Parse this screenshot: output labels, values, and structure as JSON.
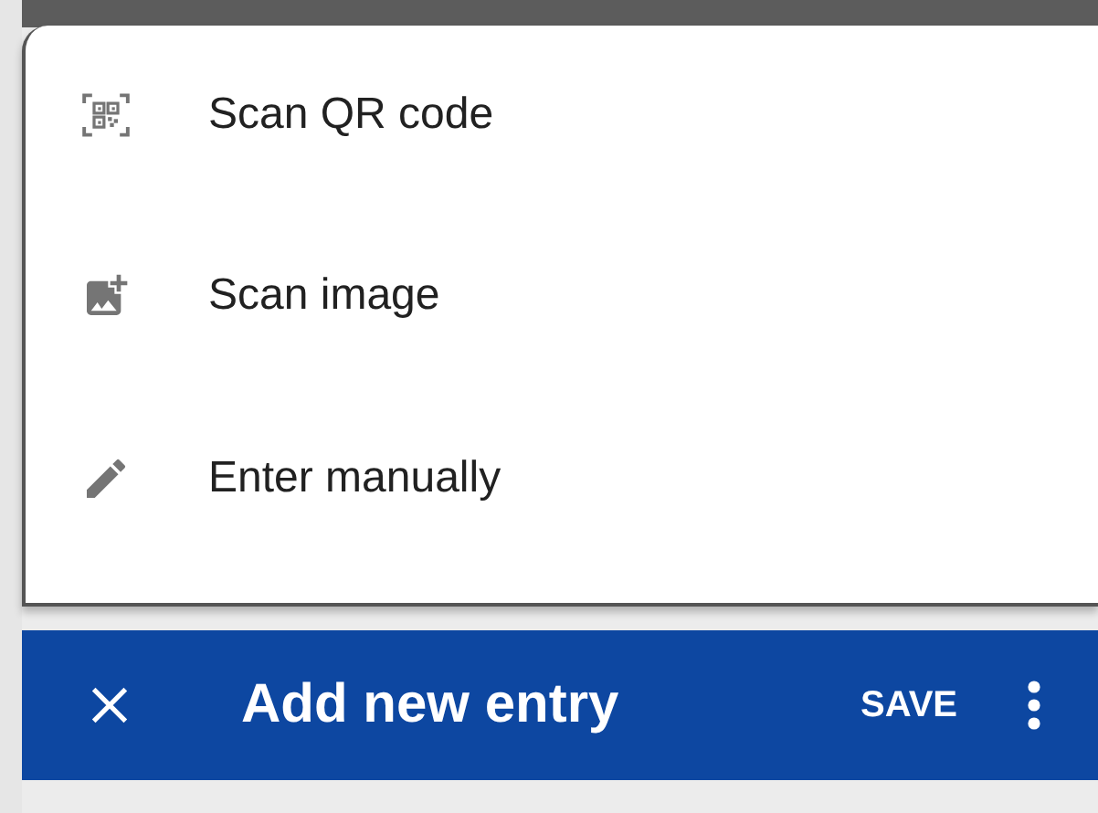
{
  "menu": {
    "items": [
      {
        "kind": "qr",
        "label": "Scan QR code"
      },
      {
        "kind": "image",
        "label": "Scan image"
      },
      {
        "kind": "edit",
        "label": "Enter manually"
      }
    ]
  },
  "toolbar": {
    "title": "Add new entry",
    "action": "SAVE"
  }
}
